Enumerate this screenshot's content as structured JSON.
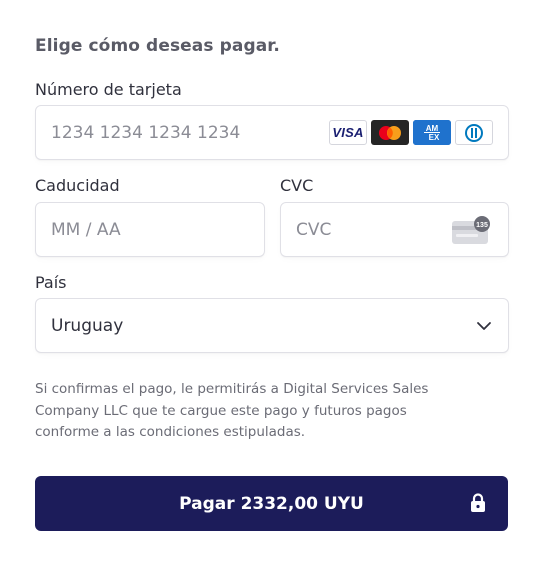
{
  "heading": "Elige cómo deseas pagar.",
  "card_number": {
    "label": "Número de tarjeta",
    "placeholder": "1234 1234 1234 1234",
    "value": "",
    "brands": [
      {
        "name": "visa-icon",
        "text": "VISA"
      },
      {
        "name": "mastercard-icon",
        "text": ""
      },
      {
        "name": "amex-icon",
        "text": "AM EX"
      },
      {
        "name": "diners-club-icon",
        "text": ""
      }
    ]
  },
  "expiry": {
    "label": "Caducidad",
    "placeholder": "MM / AA",
    "value": ""
  },
  "cvc": {
    "label": "CVC",
    "placeholder": "CVC",
    "value": "",
    "icon_badge": "135"
  },
  "country": {
    "label": "País",
    "selected": "Uruguay"
  },
  "terms_text": "Si confirmas el pago, le permitirás a Digital Services Sales Company LLC que te cargue este pago y futuros pagos conforme a las condiciones estipuladas.",
  "pay_button": {
    "label": "Pagar 2332,00 UYU"
  },
  "colors": {
    "button_bg": "#1c1c5a",
    "button_text": "#ffffff",
    "border": "#e0e0e6",
    "text": "#30313d",
    "muted": "#6b6c76"
  }
}
